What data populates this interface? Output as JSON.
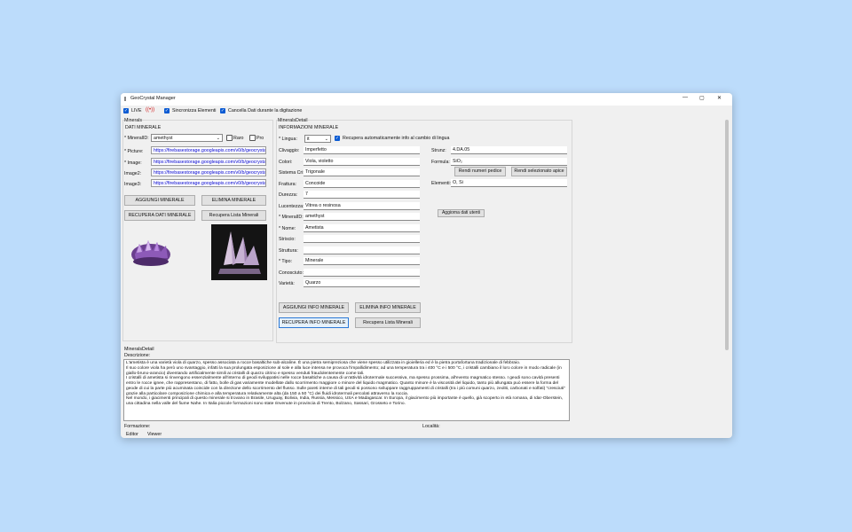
{
  "window": {
    "title": "GeoCrystal Manager",
    "controls": [
      "—",
      "▢",
      "✕"
    ]
  },
  "toolbar": {
    "live_label": "LIVE",
    "sync_label": "Sincronizza Elementi",
    "clear_label": "Cancella Dati durante la digitazione"
  },
  "minerals": {
    "group_title": "Minerals",
    "section_title": "DATI MINERALE",
    "mineral_id_label": "* MineralID:",
    "mineral_id_value": "amethyst",
    "raro_label": "Raro",
    "pro_label": "Pro",
    "picture_label": "* Picture:",
    "image_label": "* Image:",
    "image2_label": "Image2:",
    "image3_label": "Image3:",
    "url_value": "https://firebasestorage.googleapis.com/v0/b/geocrysta",
    "add_button": "AGGIUNGI MINERALE",
    "delete_button": "ELIMINA MINERALE",
    "fetch_button": "RECUPERA DATI MINERALE",
    "fetch_list_button": "Recupera Lista Minerali"
  },
  "detail": {
    "group_title": "MineralsDetail",
    "section_title": "INFORMAZIONI MINERALE",
    "lingua_label": "* Lingua:",
    "lingua_value": "it",
    "auto_label": "Recupera automaticamente info al cambio di lingua",
    "fields": [
      {
        "label": "Clivaggio:",
        "value": "Imperfetto"
      },
      {
        "label": "Colori:",
        "value": "Viola, violetto"
      },
      {
        "label": "Sistema Cri:",
        "value": "Trigonale"
      },
      {
        "label": "Frattura:",
        "value": "Concoide"
      },
      {
        "label": "Durezza:",
        "value": "7"
      },
      {
        "label": "Lucentezza:",
        "value": "Vitrea o resinosa"
      },
      {
        "label": "* MineralID:",
        "value": "amethyst"
      },
      {
        "label": "* Nome:",
        "value": "Ametista"
      },
      {
        "label": "Striscio:",
        "value": ""
      },
      {
        "label": "Struttura:",
        "value": ""
      },
      {
        "label": "* Tipo:",
        "value": "Minerale"
      },
      {
        "label": "Conosciuto:",
        "value": ""
      },
      {
        "label": "Varietà:",
        "value": "Quarzo"
      }
    ],
    "strunz_label": "Strunz:",
    "strunz_value": "4.DA.05",
    "formula_label": "Formula:",
    "formula_value": "SiO₂",
    "pedice_button": "Rendi numeri pedice",
    "apice_button": "Rendi selezionato apice",
    "elementi_label": "Elementi:",
    "elementi_value": "O, Si",
    "add_users_button": "Aggiorna dati utenti",
    "add_info_button": "AGGIUNGI INFO MINERALE",
    "delete_info_button": "ELIMINA INFO MINERALE",
    "fetch_info_button": "RECUPERA INFO MINERALE",
    "fetch_list_button": "Recupera Lista Minerali"
  },
  "bottom": {
    "group_title": "MineralsDetail",
    "descrizione_label": "Descrizione:",
    "description": "L'ametista è una varietà viola di quarzo, spesso associata a rocce basaltiche sub-alcaline. È una pietra semipreziosa che viene spesso utilizzata in gioielleria ed è la pietra portafortuna tradizionale di febbraio.\nIl suo colore viola ha però uno svantaggio, infatti la sua prolungata esposizione al sole e alla luce intensa ne provoca l'impallidimento; ad una temperatura tra i 400 °C e i 500 °C, i cristalli cambiano il loro colore in modo radicale (in giallo-bruno-arancio) diventando artificialmente simili ai cristalli di quarzo citrino e spesso venduti fraudolentemente come tali.\nI cristalli di ametista si rinvengono essenzialmente all'interno di geodi sviluppatisi nelle rocce basaltiche a causa di un'attività idrotermale successiva, ma spesso prossima, all'evento magmatico stesso. I geodi sono cavità presenti entro le rocce ignee, che rappresentano, di fatto, bolle di gas variamente modellate dallo scorrimento maggiore o minore del liquido magmatico. Quanto minore è la viscosità del liquido, tanto più allungata può essere la forma del geode di cui la parte più acuminata coincide con la direzione dello scorrimento del flusso. Sulle pareti interne di tali geodi si possono sviluppare raggruppamenti di cristalli (tra i più comuni quarzo, zeoliti, carbonati e solfati) \"cresciuti\" grazie alla particolare composizione chimica e alla temperatura relativamente alta (da 150 a 50 °C) dei fluidi idrotermali percolati attraverso la roccia.\nNel mondo, i giacimenti principali di questo minerale si trovano in Brasile, Uruguay, Bolivia, India, Russia, Messico, USA e Madagascar. In Europa, il giacimento più importante è quello, già scoperto in età romana, di Idar-Oberstein, una cittadina nella valle del fiume Nahe. In Italia piccole formazioni sono state rinvenute in provincia di Trento, Bolzano, Sassari, Grosseto e Torino.",
    "formazione_label": "Formazione:",
    "localita_label": "Località:"
  },
  "tabs": [
    "Editor",
    "Viewer"
  ]
}
